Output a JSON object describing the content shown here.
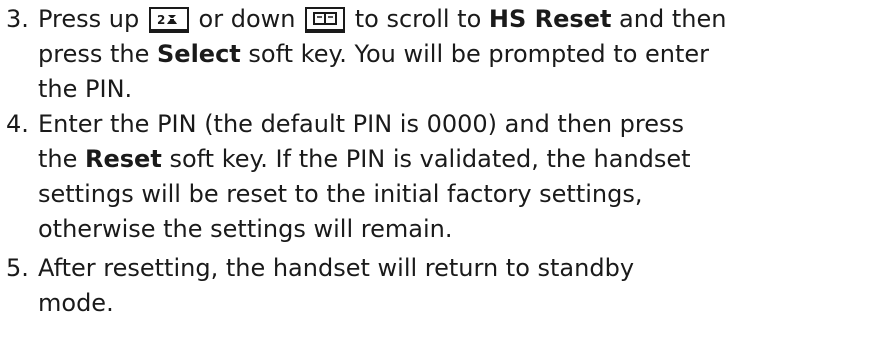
{
  "steps": [
    {
      "number": "3.",
      "line1": {
        "pre": "Press up",
        "mid": " or down",
        "post": " to scroll to ",
        "bold": "HS Reset",
        "end": " and then"
      },
      "line2": {
        "pre": "press the ",
        "bold": "Select",
        "post": " soft key.  You will be prompted to enter"
      },
      "line3": "the PIN."
    },
    {
      "number": "4.",
      "line1": "Enter the PIN (the default PIN is 0000) and then press",
      "line2": {
        "pre": "the ",
        "bold": "Reset",
        "post": " soft key.  If the PIN is validated, the handset"
      },
      "line3": "settings will be reset to the initial factory settings,",
      "line4": "otherwise the settings will remain."
    },
    {
      "number": "5.",
      "line1": "After resetting, the handset will return to standby",
      "line2": "mode."
    }
  ],
  "keys": {
    "up": {
      "icon": "redial-phone-icon",
      "label": "up key"
    },
    "down": {
      "icon": "phonebook-icon",
      "label": "down key"
    }
  }
}
